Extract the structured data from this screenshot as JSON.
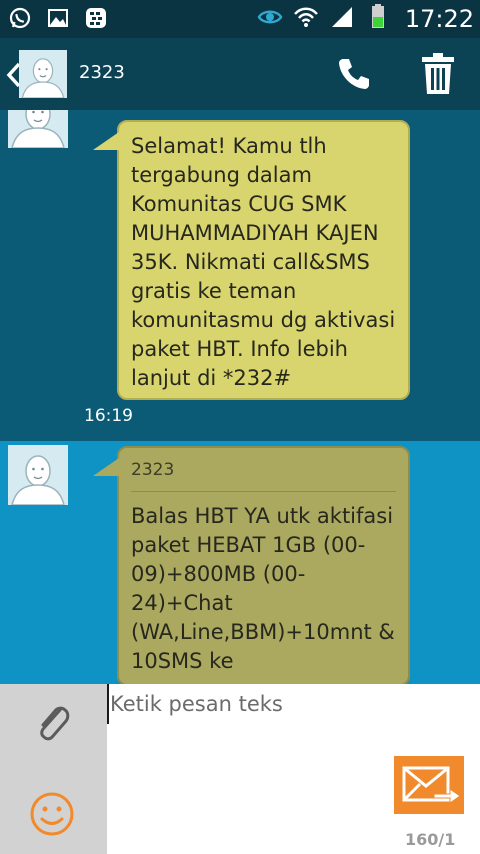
{
  "status_bar": {
    "time": "17:22",
    "icons": [
      "whatsapp-icon",
      "gallery-icon",
      "bbm-icon",
      "eye-icon",
      "wifi-icon",
      "signal-icon",
      "battery-icon"
    ]
  },
  "header": {
    "contact_name": "2323"
  },
  "messages": [
    {
      "text": "Selamat! Kamu tlh tergabung dalam Komunitas CUG SMK MUHAMMADIYAH KAJEN 35K. Nikmati call&SMS gratis ke teman komunitasmu dg aktivasi paket HBT. Info lebih lanjut di *232#",
      "time": "16:19"
    },
    {
      "sender": "2323",
      "text": "Balas HBT YA utk aktifasi paket HEBAT 1GB (00-09)+800MB (00-24)+Chat (WA,Line,BBM)+10mnt & 10SMS ke"
    }
  ],
  "composer": {
    "placeholder": "Ketik pesan teks",
    "char_counter": "160/1"
  },
  "colors": {
    "status_bar": "#0b3442",
    "action_bar": "#0b4355",
    "thread_dark": "#0b5a76",
    "thread_light": "#0e93c4",
    "bubble": "#d8d46e",
    "send_button": "#f08a2c",
    "emoji_icon": "#f08a2c"
  }
}
